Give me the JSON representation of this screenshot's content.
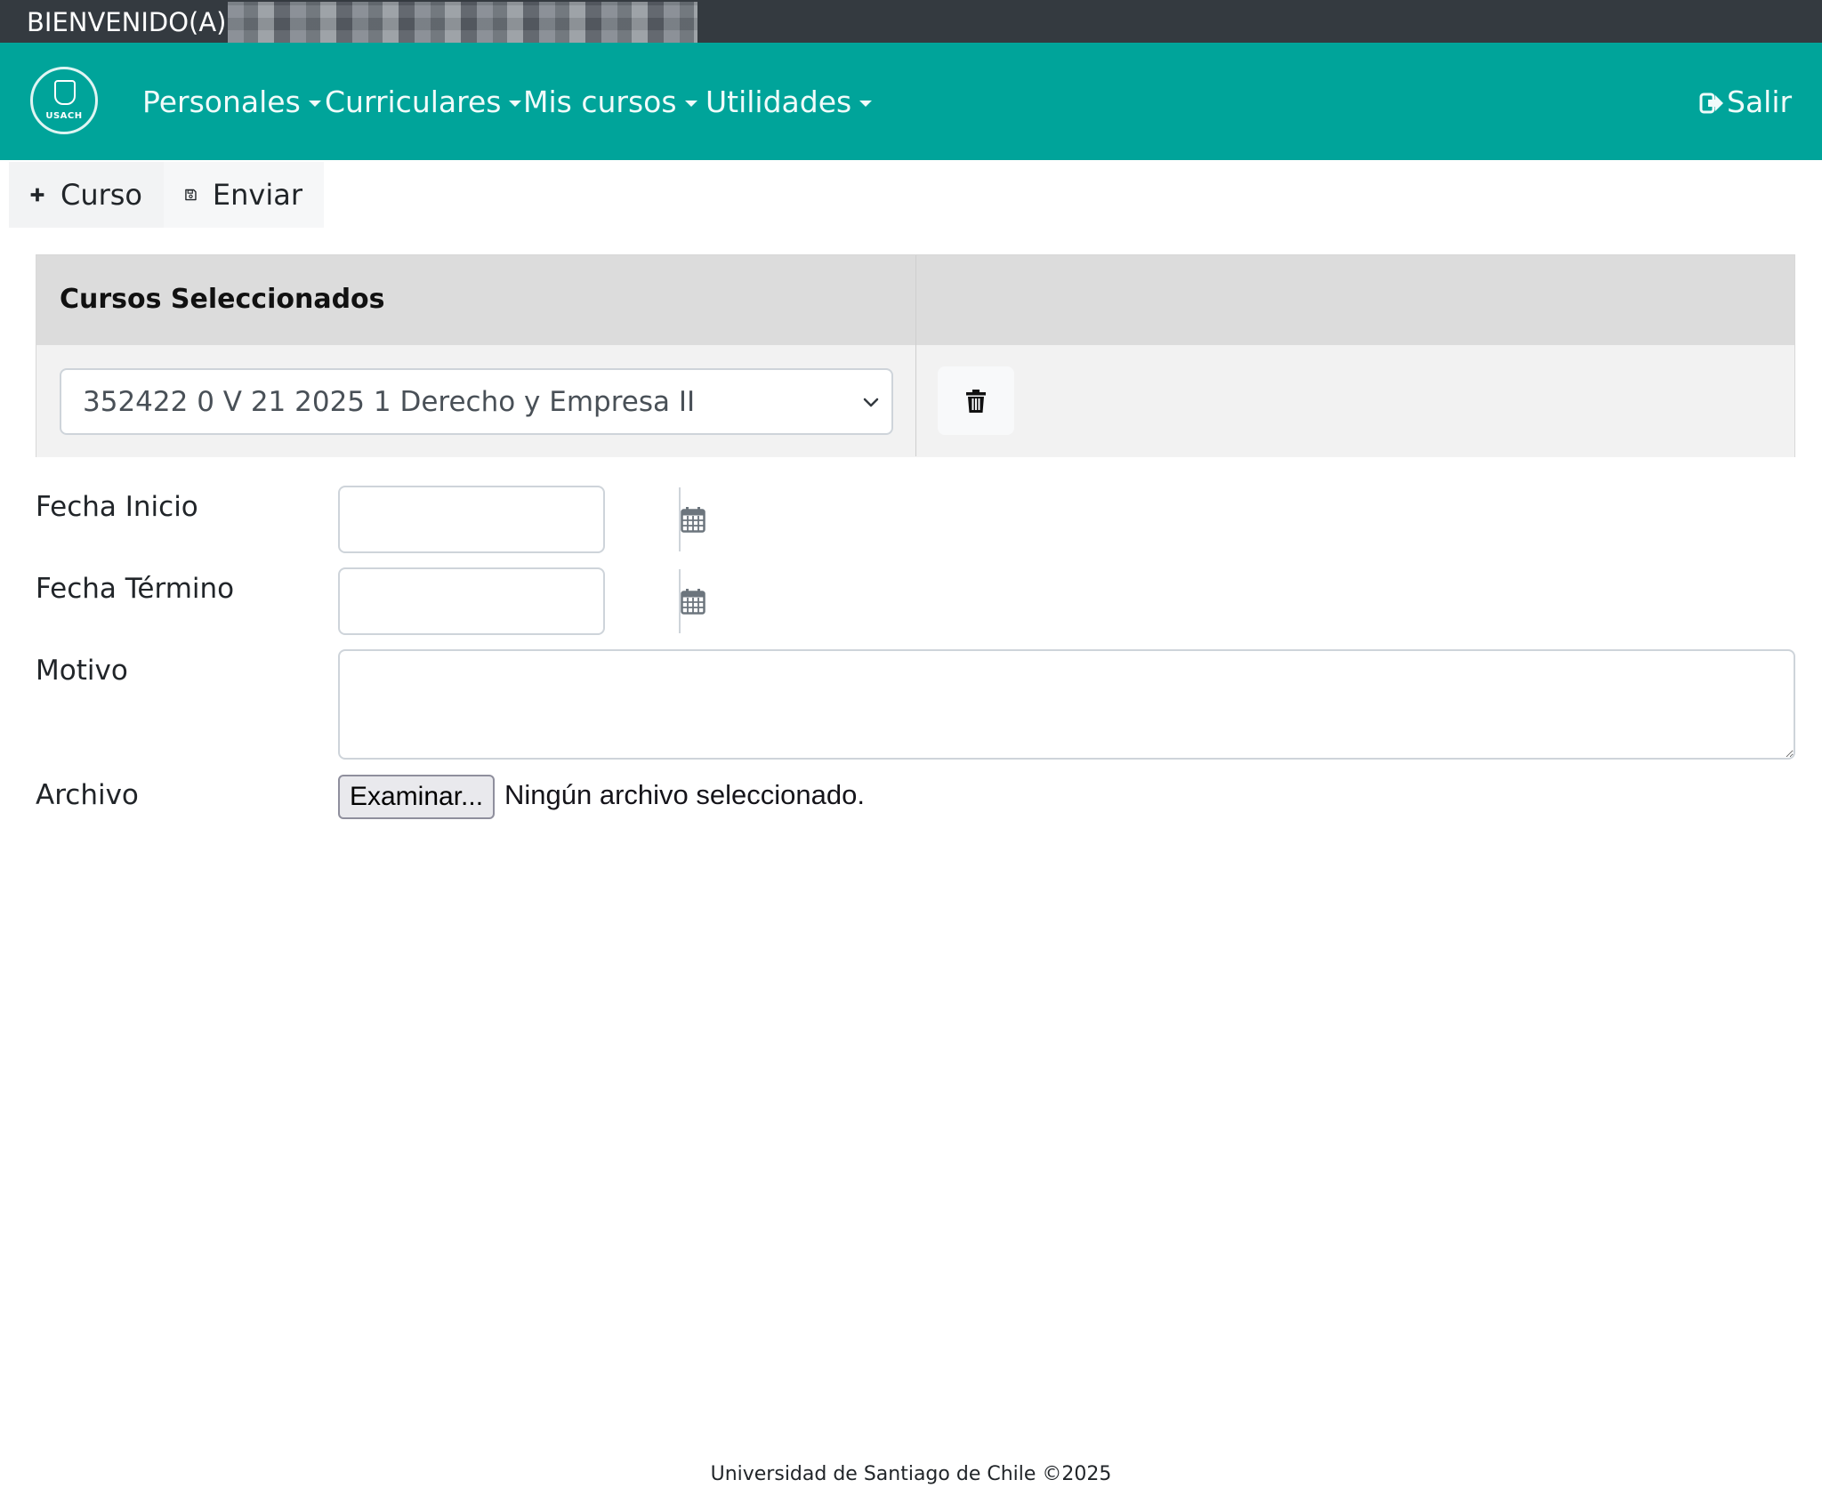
{
  "welcome_bar": {
    "label": "BIENVENIDO(A)"
  },
  "navbar": {
    "logo_text": "USACH",
    "items": [
      {
        "label": "Personales"
      },
      {
        "label": "Curriculares"
      },
      {
        "label": "Mis cursos"
      },
      {
        "label": "Utilidades"
      }
    ],
    "exit_label": "Salir",
    "background_color": "#00a49a"
  },
  "toolbar": {
    "add_course_label": "Curso",
    "send_label": "Enviar"
  },
  "courses_table": {
    "header_title": "Cursos Seleccionados",
    "selected_course": "352422 0 V 21 2025 1 Derecho y Empresa II"
  },
  "form": {
    "fecha_inicio_label": "Fecha Inicio",
    "fecha_inicio_value": "",
    "fecha_termino_label": "Fecha Término",
    "fecha_termino_value": "",
    "motivo_label": "Motivo",
    "motivo_value": "",
    "archivo_label": "Archivo",
    "browse_button_label": "Examinar...",
    "file_status": "Ningún archivo seleccionado."
  },
  "footer": {
    "text": "Universidad de Santiago de Chile ©2025"
  }
}
